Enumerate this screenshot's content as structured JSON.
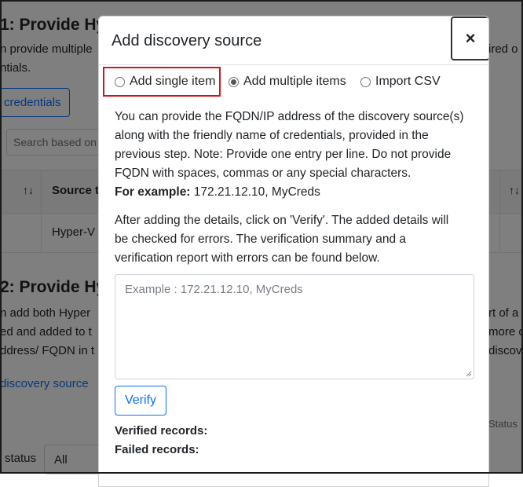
{
  "background": {
    "step1_heading": "1: Provide Hyp",
    "step1_line1": "n provide multiple",
    "step1_line1_right": "ired o",
    "step1_line2": "ntials.",
    "credentials_button": "credentials",
    "search_placeholder": "Search based on",
    "table_header_source": "Source t",
    "sort_icon_text": "↑↓",
    "table_row_value": "Hyper-V",
    "step2_heading": "2: Provide Hy",
    "step2_line1": "n add both Hyper",
    "step2_line1_right": "rt of a",
    "step2_line2": "ed and added to t",
    "step2_line2_right": "more o",
    "step2_line3": "ddress/ FQDN in t",
    "step2_line3_right": "discove",
    "discovery_source_button": "discovery source",
    "status_label": "status",
    "status_select_value": "All",
    "status_column_right": "Status"
  },
  "modal": {
    "title": "Add discovery source",
    "close_label": "×",
    "radio_options": [
      {
        "label": "Add single item",
        "checked": false
      },
      {
        "label": "Add multiple items",
        "checked": true
      },
      {
        "label": "Import CSV",
        "checked": false
      }
    ],
    "description_lines": [
      "You can provide the FQDN/IP address of the discovery source(s)",
      "along with the friendly name of credentials, provided in the",
      "previous step. Note: Provide one entry per line. Do not provide",
      "FQDN with spaces, commas or any special characters."
    ],
    "example_label": "For example:",
    "example_value": " 172.21.12.10, MyCreds",
    "after_lines": [
      "After adding the details, click on 'Verify'. The added details will",
      "be checked for errors. The verification summary and a",
      "verification report with errors can be found below."
    ],
    "textarea_placeholder": "Example : 172.21.12.10, MyCreds",
    "verify_label": "Verify",
    "verified_records_label": "Verified records:",
    "failed_records_label": "Failed records:"
  },
  "colors": {
    "primary": "#0d6efd",
    "highlight_border": "#d0161a",
    "overlay": "rgba(0,0,0,0.5)"
  }
}
